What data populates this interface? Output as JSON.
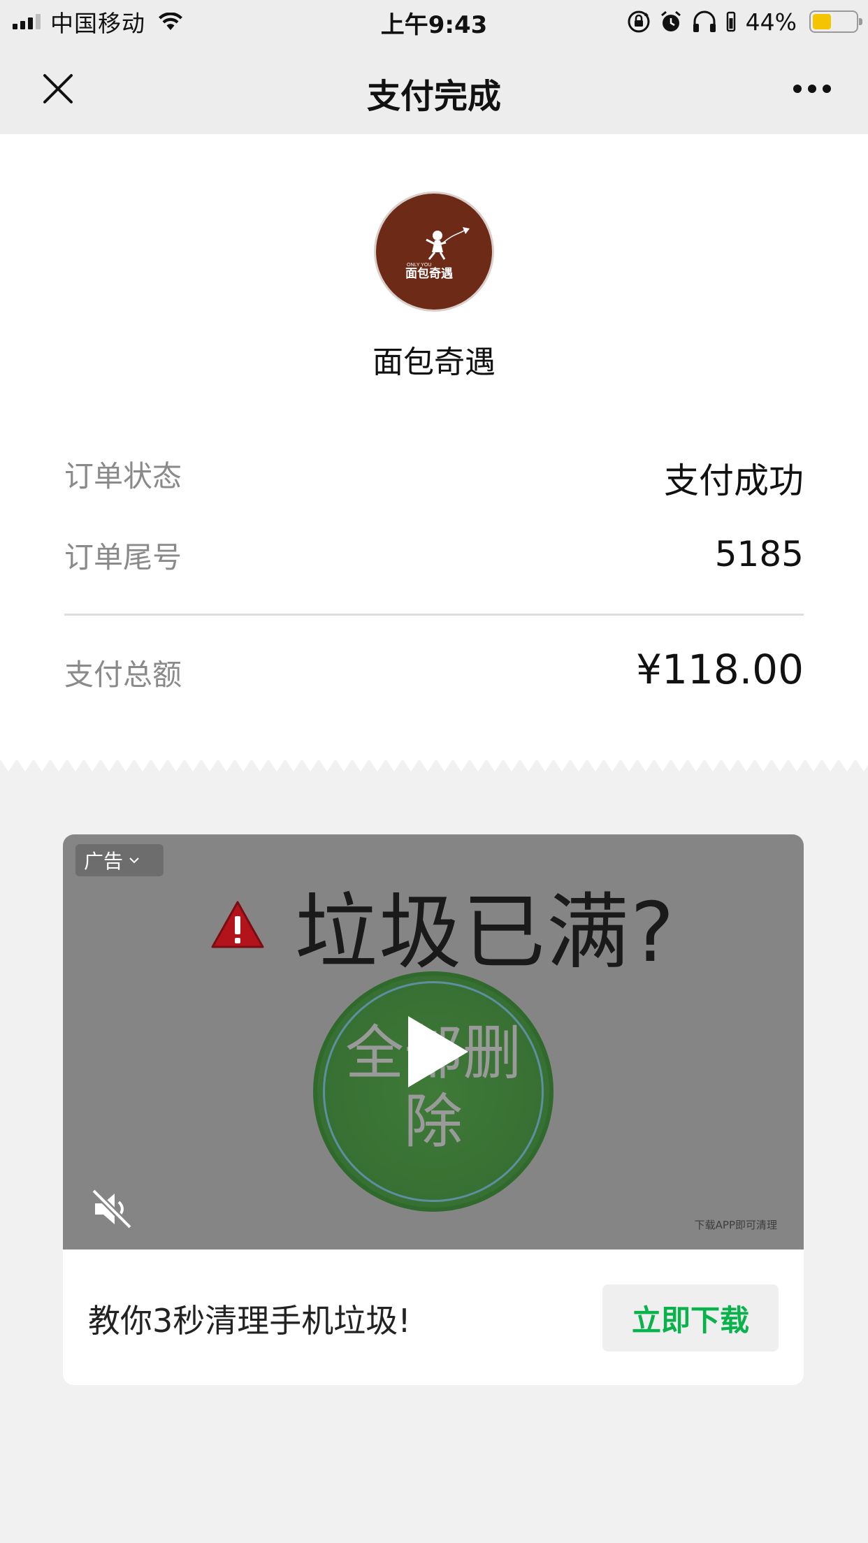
{
  "status_bar": {
    "carrier": "中国移动",
    "time": "上午9:43",
    "battery_percent": "44%",
    "battery_level": 0.44
  },
  "nav": {
    "title": "支付完成",
    "close_icon": "close-icon",
    "more_icon": "more-icon"
  },
  "merchant": {
    "name": "面包奇遇",
    "logo": {
      "tagline": "ONLY YOU",
      "name": "面包奇遇"
    }
  },
  "order": {
    "status_label": "订单状态",
    "status_value": "支付成功",
    "tail_label": "订单尾号",
    "tail_value": "5185",
    "total_label": "支付总额",
    "total_value": "¥118.00"
  },
  "ad": {
    "badge": "广告",
    "headline": "垃圾已满?",
    "circle_text": "全部删除",
    "watermark": "下载APP即可清理",
    "description": "教你3秒清理手机垃圾!",
    "cta": "立即下载",
    "cta_color": "#09b24b"
  }
}
